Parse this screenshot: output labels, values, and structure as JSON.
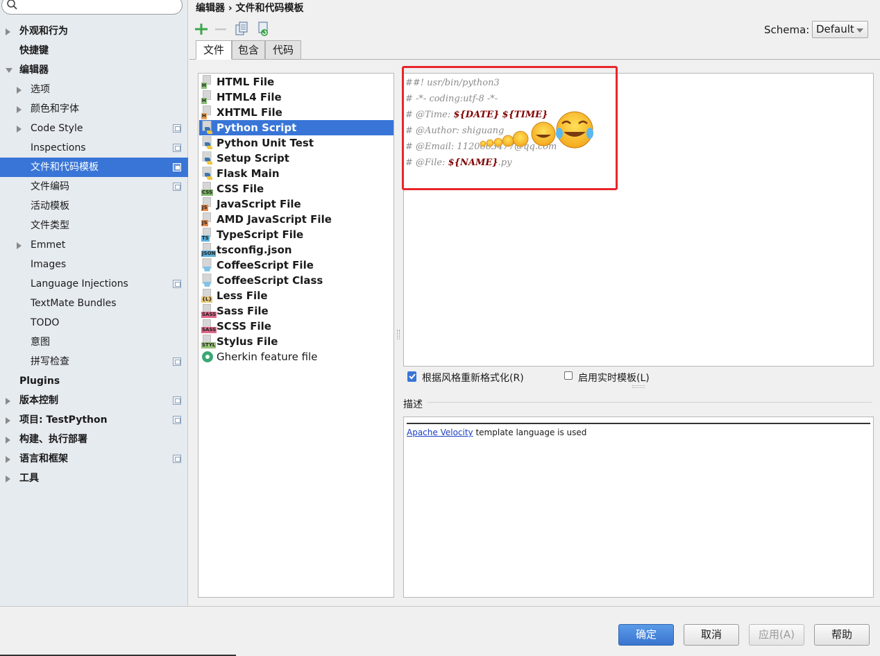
{
  "sidebar": {
    "search": {
      "placeholder": "",
      "icon": "search-icon"
    },
    "items": [
      {
        "label": "外观和行为",
        "level": 0,
        "arrow": "right",
        "bold": true,
        "proj": false
      },
      {
        "label": "快捷键",
        "level": 0,
        "arrow": "none",
        "bold": true,
        "proj": false
      },
      {
        "label": "编辑器",
        "level": 0,
        "arrow": "down",
        "bold": true,
        "proj": false
      },
      {
        "label": "选项",
        "level": 1,
        "arrow": "right",
        "bold": false,
        "proj": false
      },
      {
        "label": "颜色和字体",
        "level": 1,
        "arrow": "right",
        "bold": false,
        "proj": false
      },
      {
        "label": "Code Style",
        "level": 1,
        "arrow": "right",
        "bold": false,
        "proj": true
      },
      {
        "label": "Inspections",
        "level": 1,
        "arrow": "none",
        "bold": false,
        "proj": true
      },
      {
        "label": "文件和代码模板",
        "level": 1,
        "arrow": "none",
        "bold": false,
        "proj": true,
        "selected": true
      },
      {
        "label": "文件编码",
        "level": 1,
        "arrow": "none",
        "bold": false,
        "proj": true
      },
      {
        "label": "活动模板",
        "level": 1,
        "arrow": "none",
        "bold": false,
        "proj": false
      },
      {
        "label": "文件类型",
        "level": 1,
        "arrow": "none",
        "bold": false,
        "proj": false
      },
      {
        "label": "Emmet",
        "level": 1,
        "arrow": "right",
        "bold": false,
        "proj": false
      },
      {
        "label": "Images",
        "level": 1,
        "arrow": "none",
        "bold": false,
        "proj": false
      },
      {
        "label": "Language Injections",
        "level": 1,
        "arrow": "none",
        "bold": false,
        "proj": true
      },
      {
        "label": "TextMate Bundles",
        "level": 1,
        "arrow": "none",
        "bold": false,
        "proj": false
      },
      {
        "label": "TODO",
        "level": 1,
        "arrow": "none",
        "bold": false,
        "proj": false
      },
      {
        "label": "意图",
        "level": 1,
        "arrow": "none",
        "bold": false,
        "proj": false
      },
      {
        "label": "拼写检查",
        "level": 1,
        "arrow": "none",
        "bold": false,
        "proj": true
      },
      {
        "label": "Plugins",
        "level": 0,
        "arrow": "none",
        "bold": true,
        "proj": false
      },
      {
        "label": "版本控制",
        "level": 0,
        "arrow": "right",
        "bold": true,
        "proj": true
      },
      {
        "label": "项目: TestPython",
        "level": 0,
        "arrow": "right",
        "bold": true,
        "proj": true
      },
      {
        "label": "构建、执行部署",
        "level": 0,
        "arrow": "right",
        "bold": true,
        "proj": false
      },
      {
        "label": "语言和框架",
        "level": 0,
        "arrow": "right",
        "bold": true,
        "proj": true
      },
      {
        "label": "工具",
        "level": 0,
        "arrow": "right",
        "bold": true,
        "proj": false
      }
    ]
  },
  "header": {
    "breadcrumb": "编辑器 › 文件和代码模板",
    "schema_label": "Schema:",
    "schema_value": "Default"
  },
  "toolbar": {
    "buttons": [
      "add-icon",
      "remove-icon",
      "copy-icon",
      "reset-icon"
    ]
  },
  "tabs": [
    {
      "label": "文件",
      "active": true
    },
    {
      "label": "包含",
      "active": false
    },
    {
      "label": "代码",
      "active": false
    }
  ],
  "files": [
    {
      "name": "HTML File",
      "tag": "H",
      "tagColor": "#8bc27a",
      "selected": false,
      "bold": true
    },
    {
      "name": "HTML4 File",
      "tag": "H",
      "tagColor": "#8bc27a",
      "selected": false,
      "bold": true
    },
    {
      "name": "XHTML File",
      "tag": "H",
      "tagColor": "#e8a55a",
      "selected": false,
      "bold": true
    },
    {
      "name": "Python Script",
      "tag": "py",
      "tagColor": "python",
      "selected": true,
      "bold": true
    },
    {
      "name": "Python Unit Test",
      "tag": "py",
      "tagColor": "python",
      "selected": false,
      "bold": true
    },
    {
      "name": "Setup Script",
      "tag": "py",
      "tagColor": "python",
      "selected": false,
      "bold": true
    },
    {
      "name": "Flask Main",
      "tag": "py",
      "tagColor": "python",
      "selected": false,
      "bold": true
    },
    {
      "name": "CSS File",
      "tag": "CSS",
      "tagColor": "#7fb36a",
      "selected": false,
      "bold": true
    },
    {
      "name": "JavaScript File",
      "tag": "JS",
      "tagColor": "#e8884a",
      "selected": false,
      "bold": true
    },
    {
      "name": "AMD JavaScript File",
      "tag": "JS",
      "tagColor": "#e8884a",
      "selected": false,
      "bold": true
    },
    {
      "name": "TypeScript File",
      "tag": "TS",
      "tagColor": "#5ab0d8",
      "selected": false,
      "bold": true
    },
    {
      "name": "tsconfig.json",
      "tag": "JSON",
      "tagColor": "#5ab0d8",
      "selected": false,
      "bold": true
    },
    {
      "name": "CoffeeScript File",
      "tag": "cup",
      "tagColor": "#7ec3e8",
      "selected": false,
      "bold": true
    },
    {
      "name": "CoffeeScript Class",
      "tag": "cup",
      "tagColor": "#7ec3e8",
      "selected": false,
      "bold": true
    },
    {
      "name": "Less File",
      "tag": "{L}",
      "tagColor": "#e8c87a",
      "selected": false,
      "bold": true
    },
    {
      "name": "Sass File",
      "tag": "SASS",
      "tagColor": "#e06a8a",
      "selected": false,
      "bold": true
    },
    {
      "name": "SCSS File",
      "tag": "SASS",
      "tagColor": "#e06a8a",
      "selected": false,
      "bold": true
    },
    {
      "name": "Stylus File",
      "tag": "STYL",
      "tagColor": "#9ac27a",
      "selected": false,
      "bold": true
    },
    {
      "name": "Gherkin feature file",
      "tag": "gherkin",
      "tagColor": "#3aa876",
      "selected": false,
      "bold": false
    }
  ],
  "editor": {
    "lines": [
      {
        "prefix": "##! usr/bin/python3",
        "vars": []
      },
      {
        "prefix": "# -*- coding:utf-8 -*-",
        "vars": []
      },
      {
        "prefix": "# @Time: ",
        "vars": [
          "${DATE}",
          " ",
          "${TIME}"
        ]
      },
      {
        "prefix": "# @Author: shiguang",
        "vars": []
      },
      {
        "prefix": "# @Email: 1120663477@qq.com",
        "vars": []
      },
      {
        "prefix": "# @File: ",
        "vars": [
          "${NAME}"
        ],
        "suffix": ".py"
      }
    ]
  },
  "options": {
    "reformat_label": "根据风格重新格式化(R)",
    "live_template_label": "启用实时模板(L)",
    "live_template_checked": false
  },
  "description": {
    "title": "描述",
    "link_text": "Apache Velocity",
    "text": " template language is used"
  },
  "buttons": {
    "ok": "确定",
    "cancel": "取消",
    "apply": "应用(A)",
    "help": "帮助"
  },
  "colors": {
    "selection": "#3875d7",
    "highlight_box": "#e8262b",
    "template_var": "#800000"
  }
}
